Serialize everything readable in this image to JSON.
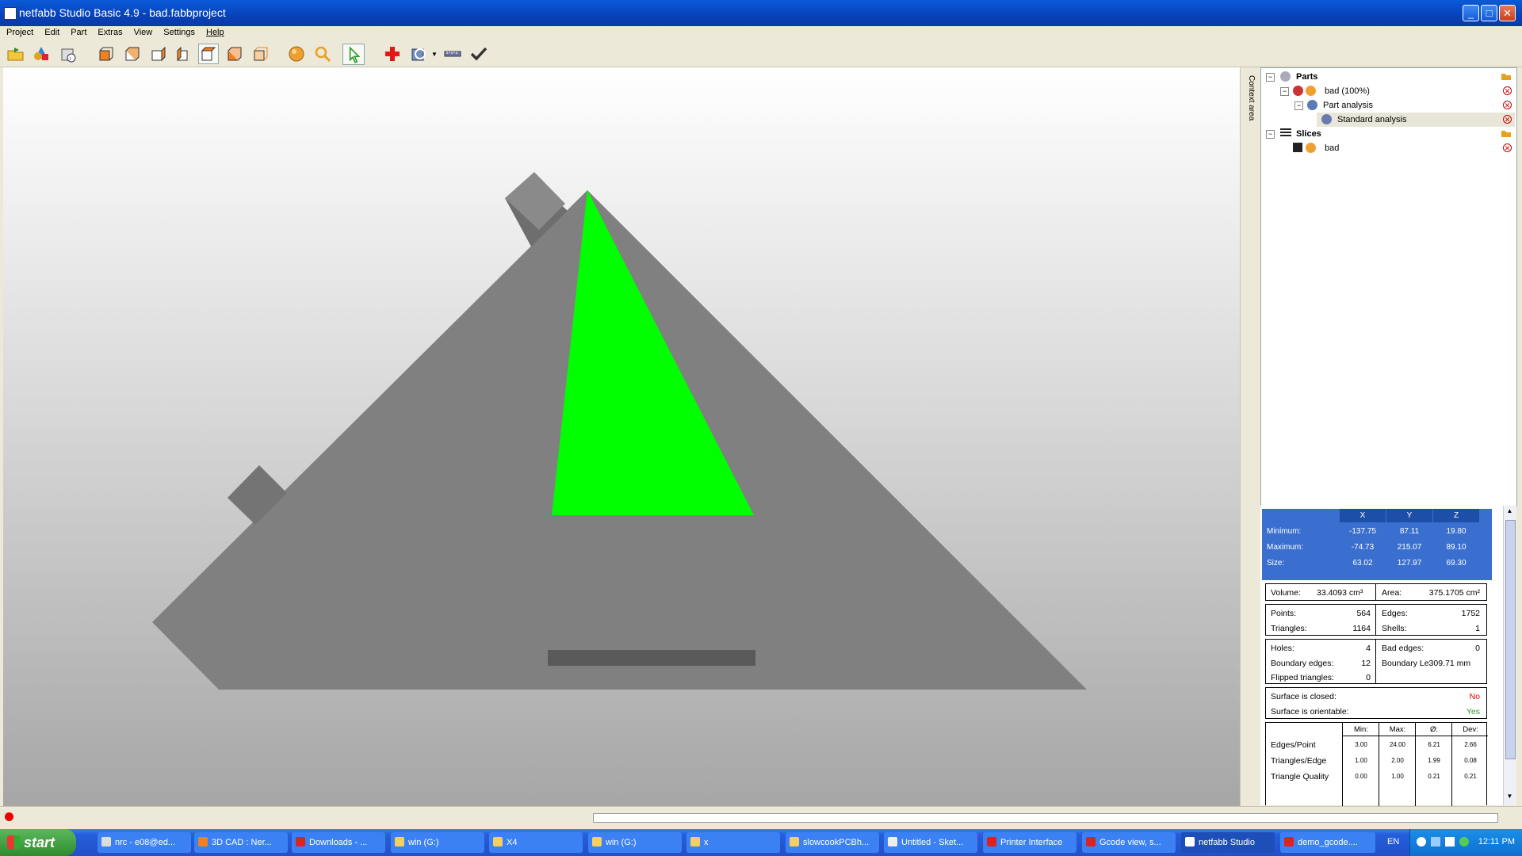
{
  "window": {
    "title": "netfabb Studio Basic 4.9 - bad.fabbproject",
    "minimize": "_",
    "maximize": "□",
    "close": "✕"
  },
  "menu": [
    "Project",
    "Edit",
    "Part",
    "Extras",
    "View",
    "Settings",
    "Help"
  ],
  "toolbar_icons": [
    "open-project-icon",
    "add-part-icon",
    "print-icon",
    "view-front-icon",
    "view-back-icon",
    "view-left-icon",
    "view-right-icon",
    "view-top-icon",
    "view-bottom-icon",
    "view-perspective-icon",
    "sphere-render-icon",
    "zoom-icon",
    "select-arrow-icon",
    "repair-cross-icon",
    "rotate-view-icon",
    "measure-ruler-icon",
    "check-icon"
  ],
  "context_area_label": "Context area",
  "tree": {
    "parts_label": "Parts",
    "part_name": "bad (100%)",
    "analysis_label": "Part analysis",
    "standard_analysis": "Standard analysis",
    "slices_label": "Slices",
    "slice_name": "bad"
  },
  "bbox": {
    "cols": [
      "X",
      "Y",
      "Z"
    ],
    "rows": [
      {
        "label": "Minimum:",
        "vals": [
          "-137.75",
          "87.11",
          "19.80"
        ]
      },
      {
        "label": "Maximum:",
        "vals": [
          "-74.73",
          "215.07",
          "89.10"
        ]
      },
      {
        "label": "Size:",
        "vals": [
          "63.02",
          "127.97",
          "69.30"
        ]
      }
    ]
  },
  "volume": {
    "label": "Volume:",
    "value": "33.4093 cm³",
    "area_label": "Area:",
    "area_value": "375.1705 cm²"
  },
  "counts": {
    "points_label": "Points:",
    "points": "564",
    "edges_label": "Edges:",
    "edges": "1752",
    "triangles_label": "Triangles:",
    "triangles": "1164",
    "shells_label": "Shells:",
    "shells": "1"
  },
  "holes": {
    "holes_label": "Holes:",
    "holes": "4",
    "bad_edges_label": "Bad edges:",
    "bad_edges": "0",
    "boundary_label": "Boundary edges:",
    "boundary": "12",
    "boundary_len": "Boundary Le309.71 mm",
    "flipped_label": "Flipped triangles:",
    "flipped": "0"
  },
  "surface": {
    "closed_label": "Surface is closed:",
    "closed": "No",
    "orient_label": "Surface is orientable:",
    "orient": "Yes",
    "no_color": "#e00000",
    "yes_color": "#2a9a2a"
  },
  "stats": {
    "cols": [
      "Min:",
      "Max:",
      "Ø:",
      "Dev:"
    ],
    "rows": [
      {
        "label": "Edges/Point",
        "vals": [
          "3.00",
          "24.00",
          "6.21",
          "2.66"
        ]
      },
      {
        "label": "Triangles/Edge",
        "vals": [
          "1.00",
          "2.00",
          "1.99",
          "0.08"
        ]
      },
      {
        "label": "Triangle Quality",
        "vals": [
          "0.00",
          "1.00",
          "0.21",
          "0.21"
        ]
      }
    ]
  },
  "taskbar": {
    "start": "start",
    "tasks": [
      "nrc - e08@ed...",
      "3D CAD : Ner...",
      "Downloads - ...",
      "win (G:)",
      "X4",
      "win (G:)",
      "x",
      "slowcookPCBh...",
      "Untitled - Sket...",
      "Printer Interface",
      "Gcode view, s...",
      "netfabb Studio",
      "demo_gcode...."
    ],
    "active_index": 11,
    "lang": "EN",
    "clock": "12:11 PM"
  },
  "colors": {
    "highlight_face": "#00ff00",
    "part_gray": "#808080",
    "slot_gray": "#5a5a5a",
    "bbox_blue": "#3a6fd0"
  }
}
